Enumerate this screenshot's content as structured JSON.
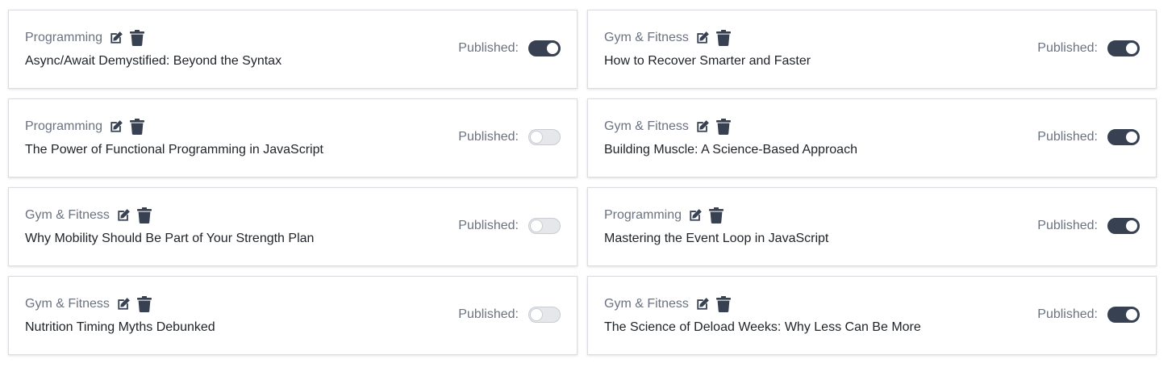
{
  "colors": {
    "toggle_on": "#374151",
    "toggle_off": "#e5e7eb",
    "icon": "#374151",
    "category_text": "#6b7280",
    "title_text": "#1f2328"
  },
  "icons": {
    "edit": "edit-icon",
    "delete": "trash-icon"
  },
  "posts": [
    {
      "category": "Programming",
      "title": "Async/Await Demystified: Beyond the Syntax",
      "published_label": "Published:",
      "published": true
    },
    {
      "category": "Gym & Fitness",
      "title": "How to Recover Smarter and Faster",
      "published_label": "Published:",
      "published": true
    },
    {
      "category": "Programming",
      "title": "The Power of Functional Programming in JavaScript",
      "published_label": "Published:",
      "published": false
    },
    {
      "category": "Gym & Fitness",
      "title": "Building Muscle: A Science-Based Approach",
      "published_label": "Published:",
      "published": true
    },
    {
      "category": "Gym & Fitness",
      "title": "Why Mobility Should Be Part of Your Strength Plan",
      "published_label": "Published:",
      "published": false
    },
    {
      "category": "Programming",
      "title": "Mastering the Event Loop in JavaScript",
      "published_label": "Published:",
      "published": true
    },
    {
      "category": "Gym & Fitness",
      "title": "Nutrition Timing Myths Debunked",
      "published_label": "Published:",
      "published": false
    },
    {
      "category": "Gym & Fitness",
      "title": "The Science of Deload Weeks: Why Less Can Be More",
      "published_label": "Published:",
      "published": true
    }
  ]
}
